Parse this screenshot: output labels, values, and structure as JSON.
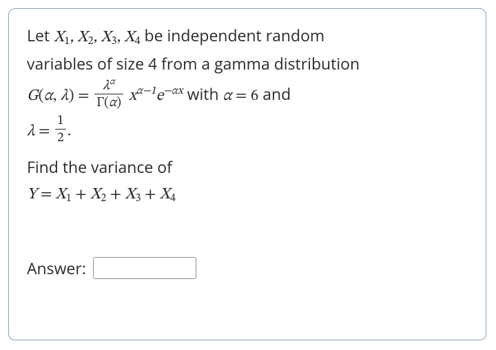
{
  "problem": {
    "intro_a": "Let ",
    "vars_list": "X₁, X₂, X₃, X₄",
    "intro_b": " be independent random",
    "intro_c": "variables  of size 4 from a gamma distribution",
    "gfun": "G(α, λ) = ",
    "frac_num": "λ",
    "frac_num_sup": "α",
    "frac_den_a": "Γ(",
    "frac_den_b": "α",
    "frac_den_c": ")",
    "after_frac_a": "x",
    "after_frac_sup": "α−1",
    "after_frac_b": "e",
    "after_frac_sup2": "−αx",
    "with_text": " with ",
    "alpha_eq": "α = 6",
    "and_text": " and",
    "lambda_eq_a": "λ = ",
    "lambda_num": "1",
    "lambda_den": "2",
    "lambda_period": ".",
    "find_text": "Find the variance of",
    "y_eq": "Y = X₁ + X₂ + X₃ + X₄"
  },
  "answer": {
    "label": "Answer:",
    "value": ""
  }
}
